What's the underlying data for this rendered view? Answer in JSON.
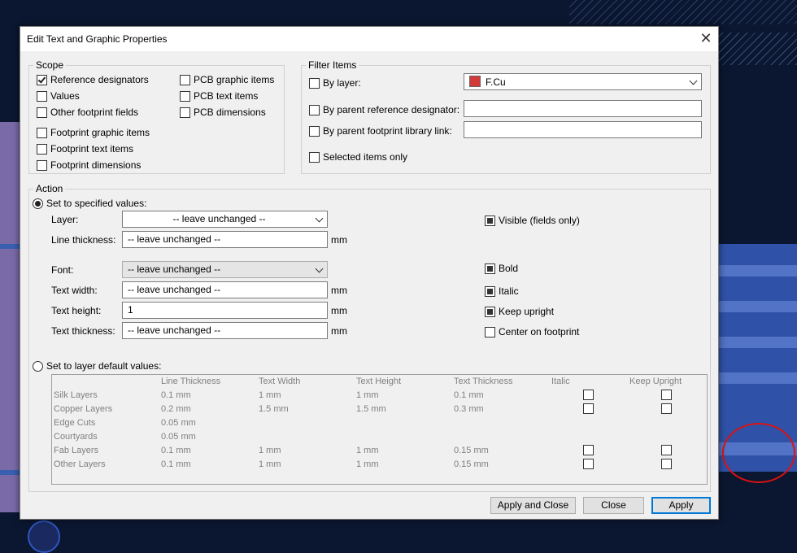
{
  "dialog": {
    "title": "Edit Text and Graphic Properties"
  },
  "scope": {
    "label": "Scope",
    "items": [
      {
        "label": "Reference designators",
        "checked": true
      },
      {
        "label": "Values",
        "checked": false
      },
      {
        "label": "Other footprint fields",
        "checked": false
      },
      {
        "label": "Footprint graphic items",
        "checked": false
      },
      {
        "label": "Footprint text items",
        "checked": false
      },
      {
        "label": "Footprint dimensions",
        "checked": false
      },
      {
        "label": "PCB graphic items",
        "checked": false
      },
      {
        "label": "PCB text items",
        "checked": false
      },
      {
        "label": "PCB dimensions",
        "checked": false
      }
    ]
  },
  "filter": {
    "label": "Filter Items",
    "by_layer": "By layer:",
    "layer_value": "F.Cu",
    "layer_color": "#d33a3a",
    "by_parent_ref": "By parent reference designator:",
    "by_parent_ref_value": "",
    "by_parent_lib": "By parent footprint library link:",
    "by_parent_lib_value": "",
    "selected_only": "Selected items only"
  },
  "action": {
    "label": "Action",
    "set_specified": "Set to specified values:",
    "layer_label": "Layer:",
    "layer_value": "-- leave unchanged --",
    "line_thickness_label": "Line thickness:",
    "line_thickness_value": "-- leave unchanged --",
    "font_label": "Font:",
    "font_value": "-- leave unchanged --",
    "text_width_label": "Text width:",
    "text_width_value": "-- leave unchanged --",
    "text_height_label": "Text height:",
    "text_height_value": "1",
    "text_thickness_label": "Text thickness:",
    "text_thickness_value": "-- leave unchanged --",
    "unit": "mm",
    "visible": "Visible  (fields only)",
    "bold": "Bold",
    "italic": "Italic",
    "keep_upright": "Keep upright",
    "center": "Center on footprint",
    "set_defaults": "Set to layer default values:"
  },
  "defaults_table": {
    "headers": [
      "Line Thickness",
      "Text Width",
      "Text Height",
      "Text Thickness",
      "Italic",
      "Keep Upright"
    ],
    "rows": [
      {
        "name": "Silk Layers",
        "line": "0.1 mm",
        "width": "1 mm",
        "height": "1 mm",
        "thick": "0.1 mm",
        "checks": true
      },
      {
        "name": "Copper Layers",
        "line": "0.2 mm",
        "width": "1.5 mm",
        "height": "1.5 mm",
        "thick": "0.3 mm",
        "checks": true
      },
      {
        "name": "Edge Cuts",
        "line": "0.05 mm",
        "width": "",
        "height": "",
        "thick": "",
        "checks": false
      },
      {
        "name": "Courtyards",
        "line": "0.05 mm",
        "width": "",
        "height": "",
        "thick": "",
        "checks": false
      },
      {
        "name": "Fab Layers",
        "line": "0.1 mm",
        "width": "1 mm",
        "height": "1 mm",
        "thick": "0.15 mm",
        "checks": true
      },
      {
        "name": "Other Layers",
        "line": "0.1 mm",
        "width": "1 mm",
        "height": "1 mm",
        "thick": "0.15 mm",
        "checks": true
      }
    ]
  },
  "buttons": {
    "apply_close": "Apply and Close",
    "close": "Close",
    "apply": "Apply"
  }
}
